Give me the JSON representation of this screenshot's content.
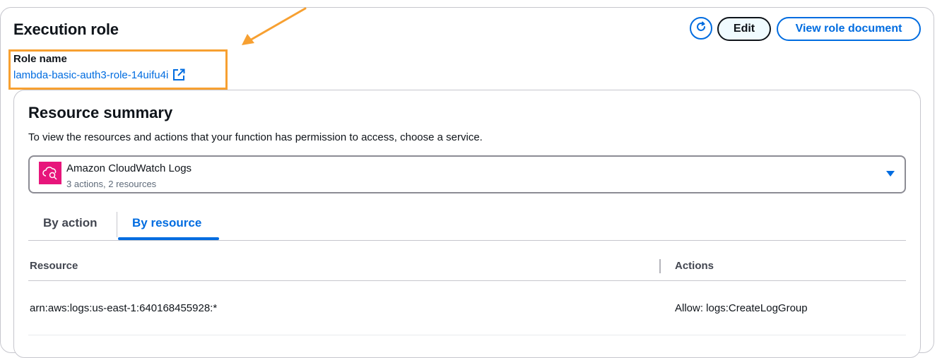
{
  "header": {
    "title": "Execution role",
    "refresh_icon": "refresh-icon",
    "edit_label": "Edit",
    "view_role_label": "View role document"
  },
  "role": {
    "label": "Role name",
    "name": "lambda-basic-auth3-role-14uifu4i",
    "link_icon": "external-link-icon"
  },
  "annotation": {
    "color": "#f7a031"
  },
  "summary": {
    "title": "Resource summary",
    "description": "To view the resources and actions that your function has permission to access, choose a service.",
    "service": {
      "name": "Amazon CloudWatch Logs",
      "detail": "3 actions, 2 resources",
      "icon": "cloudwatch-logs-icon",
      "icon_color": "#e7157b"
    },
    "tabs": [
      {
        "label": "By action",
        "active": false
      },
      {
        "label": "By resource",
        "active": true
      }
    ],
    "table": {
      "columns": [
        "Resource",
        "Actions"
      ],
      "rows": [
        {
          "resource": "arn:aws:logs:us-east-1:640168455928:*",
          "actions": "Allow: logs:CreateLogGroup"
        }
      ]
    }
  },
  "colors": {
    "accent": "#006ce0",
    "text": "#0f141a",
    "muted": "#5f6b7a"
  }
}
